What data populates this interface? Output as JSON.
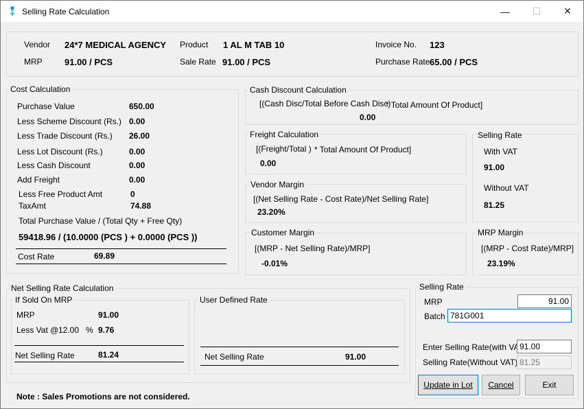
{
  "window": {
    "title": "Selling Rate Calculation",
    "minimize": "—",
    "maximize": "☐",
    "close": "✕"
  },
  "header": {
    "vendor_label": "Vendor",
    "vendor": "24*7 MEDICAL AGENCY",
    "product_label": "Product",
    "product": "1 AL M TAB 10",
    "invoice_label": "Invoice No.",
    "invoice": "123",
    "mrp_label": "MRP",
    "mrp": "91.00 / PCS",
    "sale_rate_label": "Sale Rate",
    "sale_rate": "91.00 / PCS",
    "purchase_rate_label": "Purchase Rate",
    "purchase_rate": "65.00 / PCS"
  },
  "cost": {
    "legend": "Cost Calculation",
    "purchase_value_label": "Purchase Value",
    "purchase_value": "650.00",
    "scheme_label": "Less Scheme Discount (Rs.)",
    "scheme": "0.00",
    "trade_label": "Less Trade Discount (Rs.)",
    "trade": "26.00",
    "lot_label": "Less Lot Discount (Rs.)",
    "lot": "0.00",
    "cash_label": "Less Cash Discount",
    "cash": "0.00",
    "freight_label": "Add Freight",
    "freight": "0.00",
    "free_label": "Less Free Product Amt",
    "free": "0",
    "tax_label": "TaxAmt",
    "tax": "74.88",
    "total_label": "Total Purchase Value / (Total Qty + Free Qty)",
    "total_formula": "59418.96 / (10.0000 (PCS ) + 0.0000 (PCS ))",
    "cost_rate_label": "Cost Rate",
    "cost_rate": "69.89"
  },
  "cash_disc": {
    "legend": "Cash Discount Calculation",
    "formula": "[(Cash Disc/Total Before Cash Disc)",
    "formula2": "* Total Amount Of Product]",
    "value": "0.00"
  },
  "freight": {
    "legend": "Freight Calculation",
    "formula": "[(Freight/Total )",
    "formula2": "* Total Amount Of Product]",
    "value": "0.00"
  },
  "selling_rate_box": {
    "legend": "Selling Rate",
    "with_vat_label": "With VAT",
    "with_vat": "91.00",
    "without_vat_label": "Without VAT",
    "without_vat": "81.25"
  },
  "vendor_margin": {
    "legend": "Vendor Margin",
    "formula": "[(Net Selling Rate - Cost Rate)/Net Selling Rate]",
    "value": "23.20%"
  },
  "customer_margin": {
    "legend": "Customer Margin",
    "formula": "[(MRP - Net Selling Rate)/MRP]",
    "value": "-0.01%"
  },
  "mrp_margin": {
    "legend": "MRP Margin",
    "formula": "[(MRP - Cost Rate)/MRP]",
    "value": "23.19%"
  },
  "net_selling": {
    "legend": "Net Selling Rate Calculation",
    "if_mrp_legend": "If Sold On MRP",
    "mrp_label": "MRP",
    "mrp": "91.00",
    "vat_label": "Less Vat @",
    "vat_pct": "12.00",
    "pct_sign": "%",
    "vat": "9.76",
    "net_label": "Net Selling Rate",
    "net": "81.24",
    "user_legend": "User Defined Rate",
    "user_net_label": "Net Selling Rate",
    "user_net": "91.00"
  },
  "selling_form": {
    "legend": "Selling Rate",
    "mrp_label": "MRP",
    "mrp_value": "91.00",
    "batch_label": "Batch",
    "batch_value": "781G001",
    "enter_label": "Enter Selling Rate(with VAT)",
    "enter_value": "91.00",
    "without_label": "Selling Rate(Without VAT)",
    "without_value": "81.25"
  },
  "buttons": {
    "update": "Update in Lot",
    "cancel": "Cancel",
    "exit": "Exit"
  },
  "note": "Note : Sales Promotions are not considered."
}
